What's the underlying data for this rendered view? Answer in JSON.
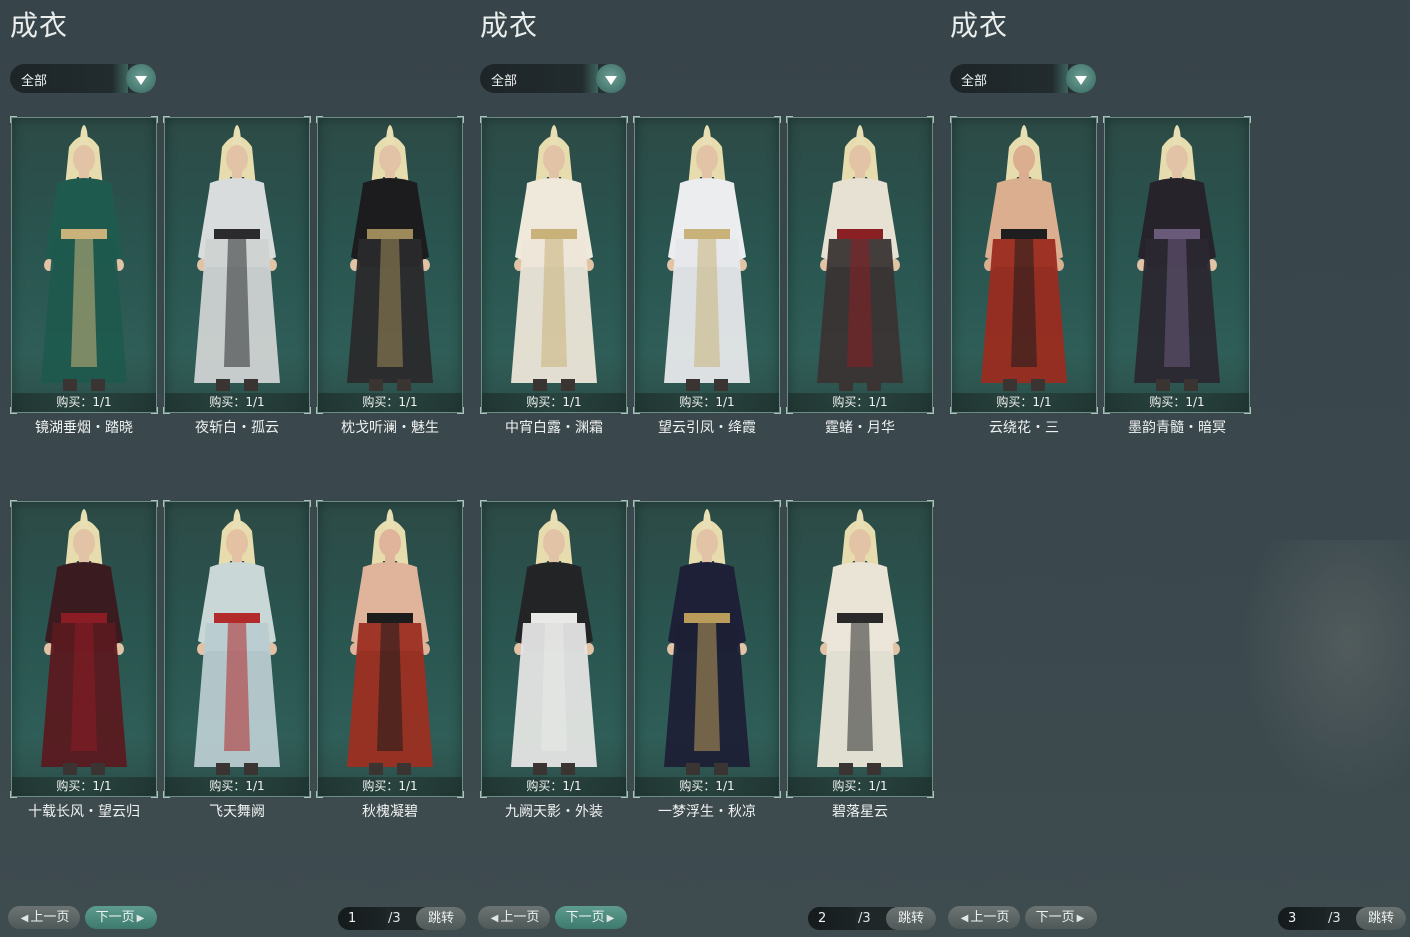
{
  "panels": [
    {
      "title": "成衣",
      "filter": "全部",
      "items": [
        {
          "buy": "购买：1/1",
          "name": "镜湖垂烟・踏晓",
          "outfit": "#1f5a4e",
          "accent": "#c9b37a",
          "skin": "#e2c3a6",
          "pants": "#1f5a4e"
        },
        {
          "buy": "购买：1/1",
          "name": "夜斩白・孤云",
          "outfit": "#d8dcdc",
          "accent": "#2b2b2e",
          "skin": "#e2c3a6",
          "pants": "#cfd3d2"
        },
        {
          "buy": "购买：1/1",
          "name": "枕戈听澜・魅生",
          "outfit": "#1c1c1e",
          "accent": "#9c8a5a",
          "skin": "#e2c3a6",
          "pants": "#2a2a2c"
        },
        {
          "buy": "购买：1/1",
          "name": "十载长风・望云归",
          "outfit": "#3a1c20",
          "accent": "#8a1c24",
          "skin": "#e2c3a6",
          "pants": "#5a1a20"
        },
        {
          "buy": "购买：1/1",
          "name": "飞天舞阙",
          "outfit": "#c9d8d6",
          "accent": "#b32a2a",
          "skin": "#e5c1a3",
          "pants": "#b9ccd0"
        },
        {
          "buy": "购买：1/1",
          "name": "秋槐凝碧",
          "outfit": "#e0b49a",
          "accent": "#1c1c1c",
          "skin": "#e0b49a",
          "pants": "#9c2f22"
        }
      ],
      "pager": {
        "prev": "上一页",
        "next": "下一页",
        "current": "1",
        "total": "/3",
        "jump": "跳转"
      }
    },
    {
      "title": "成衣",
      "filter": "全部",
      "items": [
        {
          "buy": "购买：1/1",
          "name": "中宵白露・渊霜",
          "outfit": "#efe9dc",
          "accent": "#c8b27a",
          "skin": "#e2c3a6",
          "pants": "#ece6d8"
        },
        {
          "buy": "购买：1/1",
          "name": "望云引凤・绛霞",
          "outfit": "#ecedee",
          "accent": "#c8b27a",
          "skin": "#e2c3a6",
          "pants": "#e6e8ea"
        },
        {
          "buy": "购买：1/1",
          "name": "霆蝫・月华",
          "outfit": "#e6e1d3",
          "accent": "#8a1f24",
          "skin": "#e2c3a6",
          "pants": "#3a3434"
        },
        {
          "buy": "购买：1/1",
          "name": "九阙天影・外装",
          "outfit": "#222426",
          "accent": "#e9eae8",
          "skin": "#e2c3a6",
          "pants": "#e4e5e3"
        },
        {
          "buy": "购买：1/1",
          "name": "一梦浮生・秋凉",
          "outfit": "#1d2036",
          "accent": "#b99b5a",
          "skin": "#e2c3a6",
          "pants": "#1d2036"
        },
        {
          "buy": "购买：1/1",
          "name": "碧落星云",
          "outfit": "#e9e4d6",
          "accent": "#2a2a2a",
          "skin": "#e2c3a6",
          "pants": "#ebe6d9"
        }
      ],
      "pager": {
        "prev": "上一页",
        "next": "下一页",
        "current": "2",
        "total": "/3",
        "jump": "跳转"
      }
    },
    {
      "title": "成衣",
      "filter": "全部",
      "items": [
        {
          "buy": "购买：1/1",
          "name": "云绕花・三",
          "outfit": "#dcae90",
          "accent": "#1e1e1e",
          "skin": "#dcae90",
          "pants": "#9a2c20"
        },
        {
          "buy": "购买：1/1",
          "name": "墨韵青髓・暗冥",
          "outfit": "#26232b",
          "accent": "#6a5a7a",
          "skin": "#e2c3a6",
          "pants": "#2b2832"
        }
      ],
      "pager": {
        "prev": "上一页",
        "next": "下一页",
        "current": "3",
        "total": "/3",
        "jump": "跳转"
      }
    }
  ]
}
